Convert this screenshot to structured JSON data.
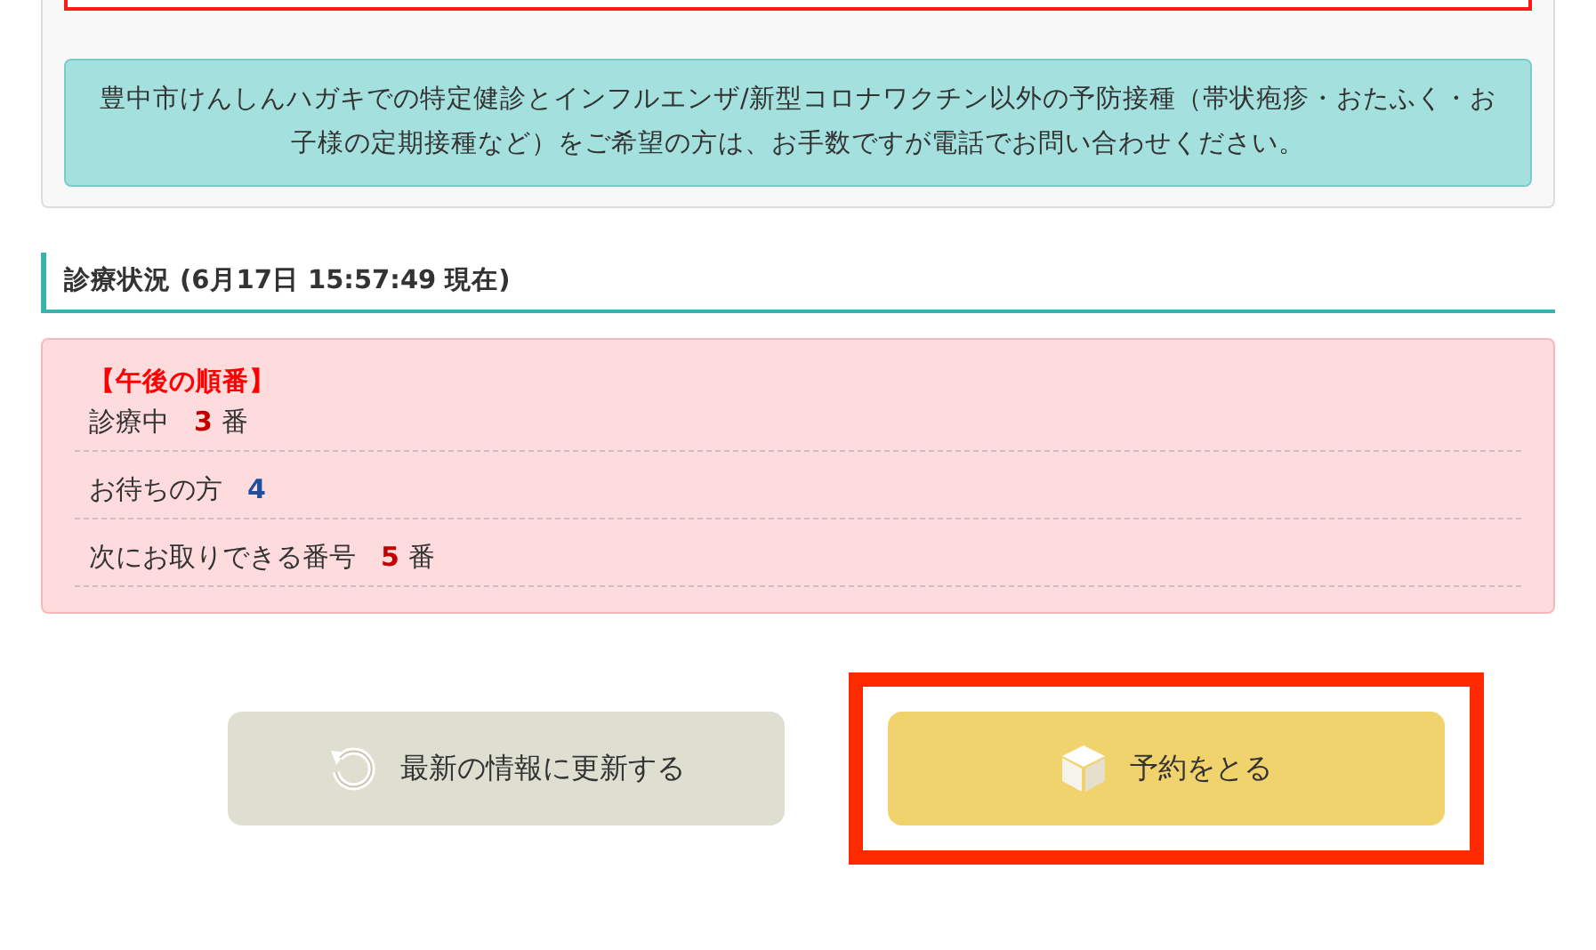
{
  "notice": "豊中市けんしんハガキでの特定健診とインフルエンザ/新型コロナワクチン以外の予防接種（帯状疱疹・おたふく・お子様の定期接種など）をご希望の方は、お手数ですが電話でお問い合わせください。",
  "status": {
    "heading": "診療状況 (6月17日 15:57:49 現在)",
    "session": "【午後の順番】",
    "rows": [
      {
        "label": "診療中",
        "value": "3",
        "unit": "番",
        "color": "#c00000"
      },
      {
        "label": "お待ちの方",
        "value": "4",
        "color": "#1f4e9c"
      },
      {
        "label": "次にお取りできる番号",
        "value": "5",
        "unit": "番",
        "color": "#c00000"
      }
    ]
  },
  "buttons": [
    {
      "kind": "refresh",
      "label": "最新の情報に更新する",
      "highlighted": false
    },
    {
      "kind": "reserve",
      "label": "予約をとる",
      "highlighted": true
    }
  ]
}
